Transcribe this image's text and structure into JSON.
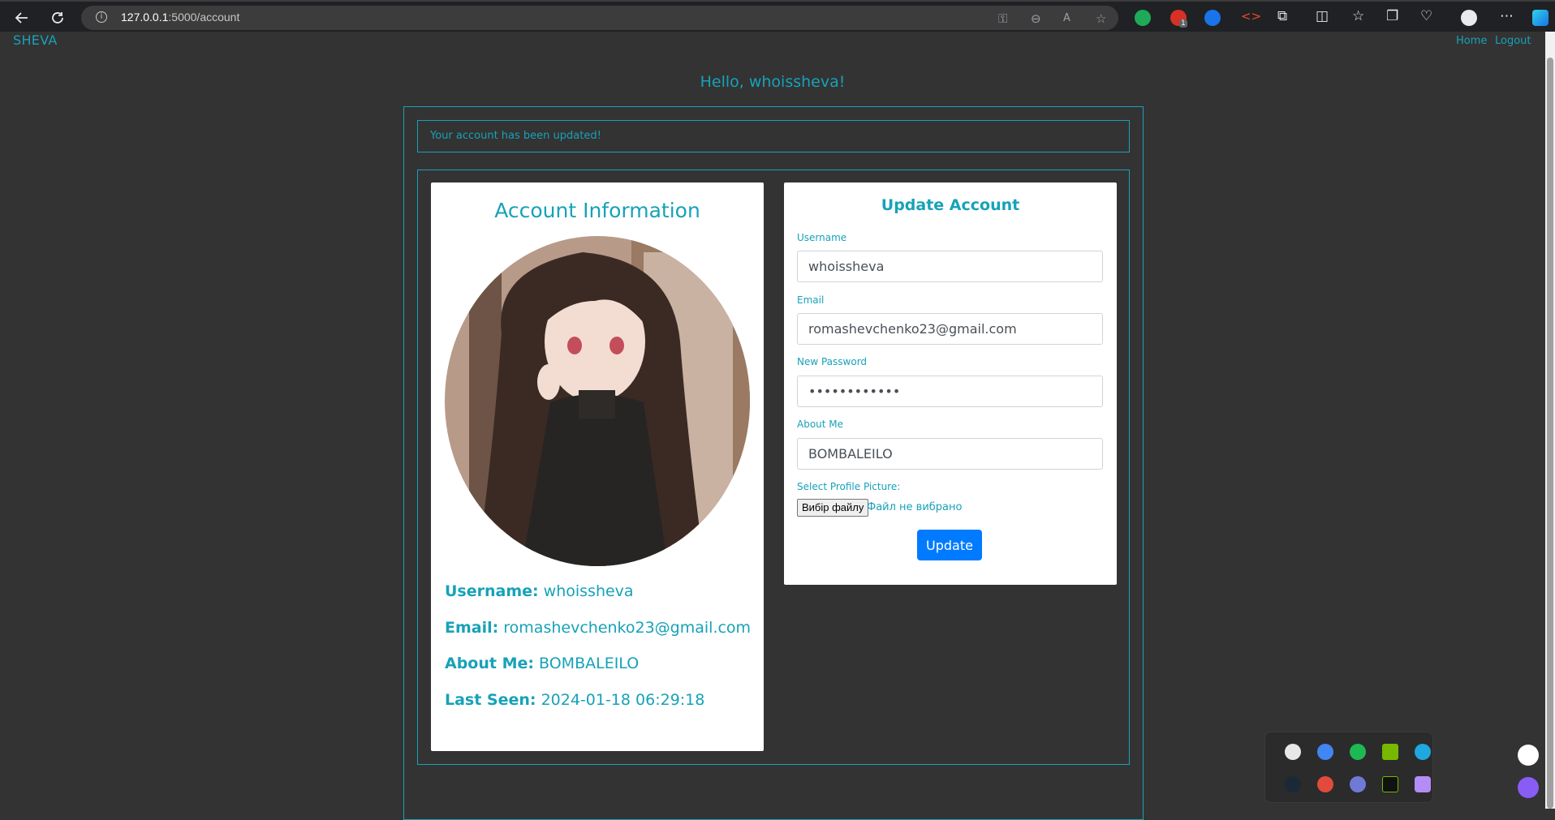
{
  "browser": {
    "url_host": "127.0.0.1",
    "url_path": ":5000/account",
    "extensions_badge": "1"
  },
  "nav": {
    "brand": "SHEVA",
    "links": [
      "Home",
      "Logout"
    ]
  },
  "page": {
    "greeting": "Hello, whoissheva!",
    "alert": "Your account has been updated!"
  },
  "account_info": {
    "title": "Account Information",
    "username_label": "Username:",
    "username": "whoissheva",
    "email_label": "Email:",
    "email": "romashevchenko23@gmail.com",
    "about_label": "About Me:",
    "about": "BOMBALEILO",
    "last_seen_label": "Last Seen:",
    "last_seen": "2024-01-18 06:29:18"
  },
  "update_form": {
    "title": "Update Account",
    "username_label": "Username",
    "username_value": "whoissheva",
    "email_label": "Email",
    "email_value": "romashevchenko23@gmail.com",
    "password_label": "New Password",
    "password_value": "••••••••••••",
    "about_label": "About Me",
    "about_value": "BOMBALEILO",
    "picture_label": "Select Profile Picture:",
    "file_button": "Вибір файлу",
    "file_status": "Файл не вибрано",
    "submit": "Update"
  },
  "colors": {
    "accent": "#17a2b8",
    "primary_button": "#007bff",
    "page_bg": "#333333"
  },
  "icons": {
    "back": "back-arrow-icon",
    "reload": "reload-icon",
    "site_info": "info-icon",
    "menu": "more-icon"
  }
}
